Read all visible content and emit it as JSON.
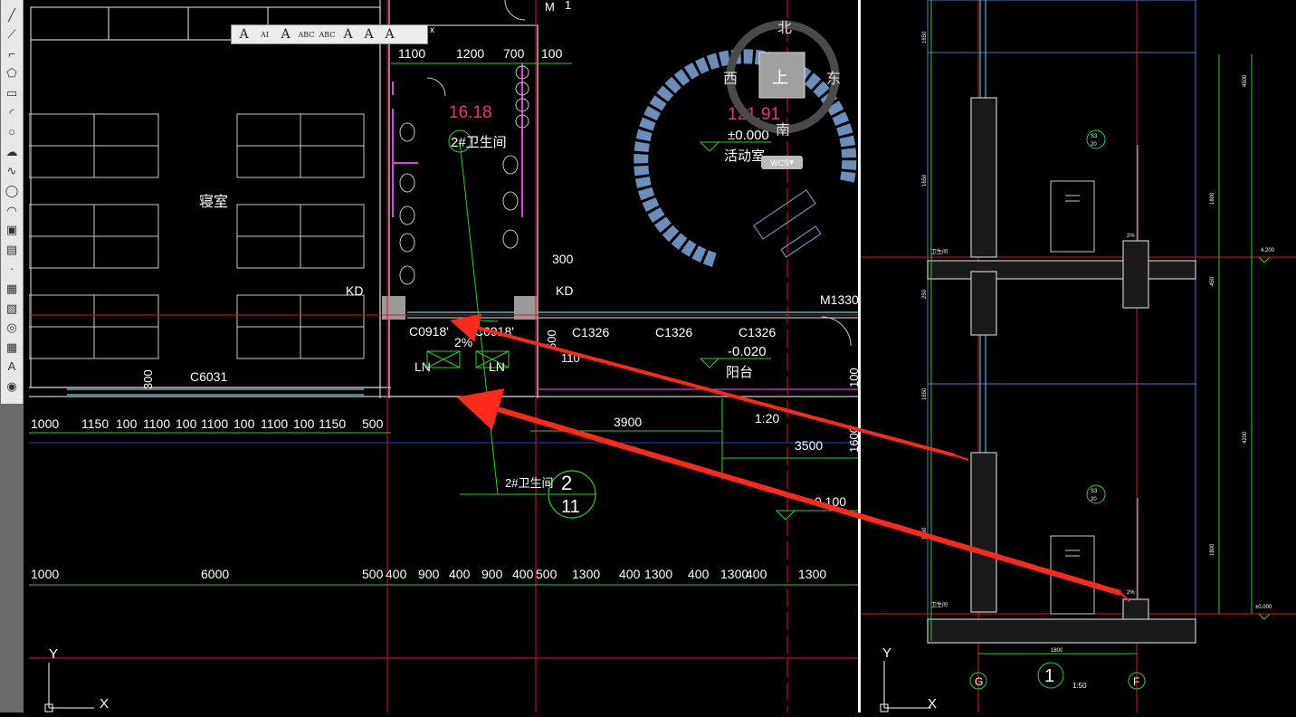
{
  "toolbar": {
    "tools": [
      "line-icon",
      "xline-icon",
      "polyline-icon",
      "polygon-icon",
      "rectangle-icon",
      "arc-icon",
      "circle-icon",
      "revcloud-icon",
      "spline-icon",
      "ellipse-icon",
      "ellipse-arc-icon",
      "insert-block-icon",
      "make-block-icon",
      "point-icon",
      "hatch-icon",
      "gradient-icon",
      "region-icon",
      "table-icon",
      "mtext-icon",
      "add-selected-icon"
    ]
  },
  "text_toolbar": {
    "tools": [
      {
        "icon": "text-icon",
        "glyph": "A"
      },
      {
        "icon": "mtext-icon",
        "glyph": "AI"
      },
      {
        "icon": "edit-text-icon",
        "glyph": "A"
      },
      {
        "icon": "find-icon",
        "glyph": "ABC"
      },
      {
        "icon": "spell-check-icon",
        "glyph": "ABC"
      },
      {
        "icon": "text-style-icon",
        "glyph": "A"
      },
      {
        "icon": "scale-text-icon",
        "glyph": "A"
      },
      {
        "icon": "justify-text-icon",
        "glyph": "A"
      },
      {
        "icon": "convert-text-icon",
        "glyph": ""
      }
    ],
    "close": "x"
  },
  "compass": {
    "north": "北",
    "south": "南",
    "east": "东",
    "west": "西",
    "center": "上"
  },
  "wcs_label": "WCS",
  "plan": {
    "rooms": {
      "bedroom": "寝室",
      "restroom_elev": "16.18",
      "restroom": "2#卫生间",
      "activity_elev": "121.91",
      "activity_level": "±0.000",
      "activity": "活动室",
      "balcony_level": "-0.020",
      "balcony": "阳台"
    },
    "labels": {
      "kd1": "KD",
      "kd2": "KD",
      "c0918a": "C0918'",
      "c0918b": "C0918'",
      "c1326a": "C1326",
      "c1326b": "C1326",
      "c1326c": "C1326",
      "c6031": "C6031",
      "m1330": "M1330",
      "slope": "2%",
      "ln1": "LN",
      "ln2": "LN",
      "d300a": "300",
      "d300b": "300",
      "d500v": "500",
      "d110": "110",
      "d1600": "1600",
      "d100v": "100",
      "slope2": "1:20",
      "d3900": "3900",
      "d3500": "3500",
      "lvl0100": "0.100",
      "callout_label": "2#卫生间",
      "callout_num": "2",
      "callout_den": "11"
    },
    "top_dims": [
      "1100",
      "1200",
      "700",
      "100"
    ],
    "row1_dims": [
      "1000",
      "1150",
      "100",
      "1100",
      "100",
      "1100",
      "100",
      "1100",
      "100",
      "1150",
      "500"
    ],
    "row2_dims": [
      "1000",
      "6000",
      "500",
      "400",
      "900",
      "400",
      "900",
      "400",
      "500",
      "1300",
      "400",
      "1300",
      "400",
      "1300",
      "400",
      "1300"
    ],
    "top_fragments": [
      "M",
      "1"
    ]
  },
  "detail": {
    "axis_g": "G",
    "axis_f": "F",
    "section_num": "1",
    "section_scale": "1:50",
    "dim_bottom": "1800",
    "left_dims": [
      "1650",
      "1650",
      "250",
      "1650",
      "1650"
    ],
    "right_dims": [
      "4500",
      "1800",
      "450",
      "4200",
      "1800"
    ],
    "levels": [
      "4.200",
      "±0.000"
    ],
    "tags": [
      "卫生间",
      "卫生间"
    ],
    "callouts": [
      "S3",
      "20",
      "S3",
      "20"
    ],
    "small_pct": [
      "2%",
      "2%"
    ]
  },
  "ucs": {
    "y": "Y",
    "x": "X"
  },
  "colors": {
    "bg": "#000000",
    "axis_red": "#e0141e",
    "dim_green": "#2ccf2c",
    "text_white": "#ffffff",
    "wall": "#c8c8c8",
    "window_cyan": "#6ad7e6",
    "magenta": "#e040e0",
    "arrow_red": "#ff2a1a",
    "furniture_blue": "#6b8fb8",
    "pink_text": "#e0387a"
  }
}
